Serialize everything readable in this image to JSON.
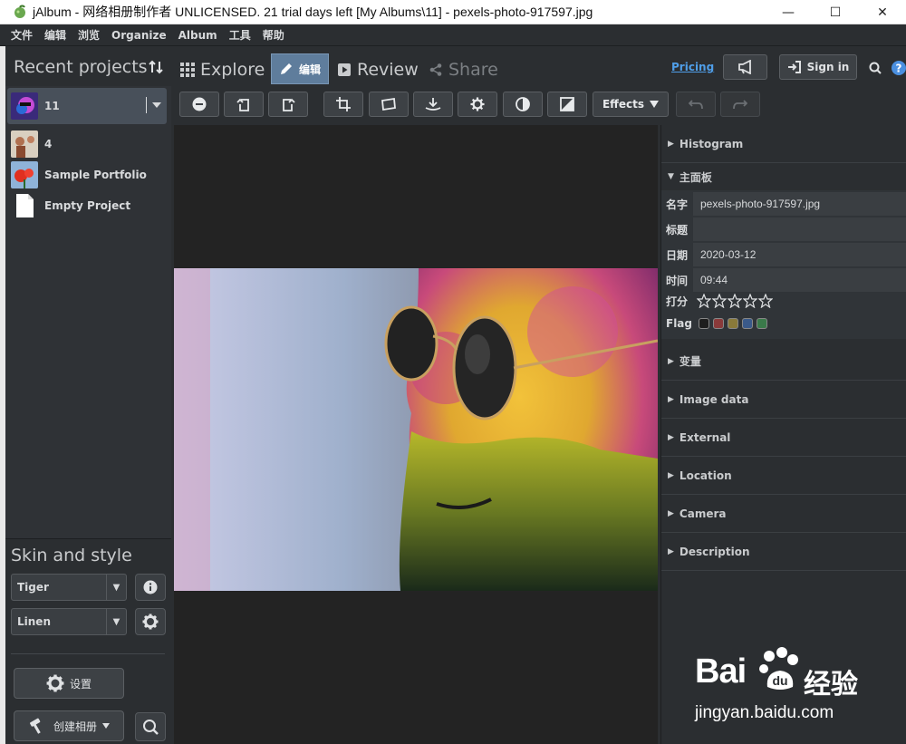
{
  "window": {
    "title": "jAlbum - 网络相册制作者 UNLICENSED. 21 trial days left [My Albums\\11] - pexels-photo-917597.jpg",
    "controls": {
      "minimize": "—",
      "maximize": "☐",
      "close": "✕"
    }
  },
  "menu": [
    "文件",
    "编辑",
    "浏览",
    "Organize",
    "Album",
    "工具",
    "帮助"
  ],
  "left": {
    "recent_header": "Recent projects",
    "projects": [
      {
        "name": "11",
        "selected": true
      },
      {
        "name": "4",
        "selected": false
      },
      {
        "name": "Sample Portfolio",
        "selected": false
      },
      {
        "name": "Empty Project",
        "selected": false
      }
    ],
    "skin_header": "Skin and style",
    "skin_value": "Tiger",
    "style_value": "Linen",
    "settings_label": "设置",
    "make_album_label": "创建相册"
  },
  "tabs": {
    "explore": "Explore",
    "edit": "编辑",
    "review": "Review",
    "share": "Share"
  },
  "topbar": {
    "pricing": "Pricing",
    "sign_in": "Sign in"
  },
  "edit_toolbar": {
    "effects": "Effects"
  },
  "right": {
    "sections_top": [
      "Histogram"
    ],
    "main_panel": "主面板",
    "fields": {
      "name_label": "名字",
      "name_value": "pexels-photo-917597.jpg",
      "title_label": "标题",
      "title_value": "",
      "date_label": "日期",
      "date_value": "2020-03-12",
      "time_label": "时间",
      "time_value": "09:44",
      "rating_label": "打分",
      "rating_value": 0,
      "flag_label": "Flag"
    },
    "flag_colors": [
      "#1e1e1e",
      "#8a3a3a",
      "#8a7a3a",
      "#3a5a8a",
      "#3a7a4a"
    ],
    "sections_bottom": [
      "变量",
      "Image data",
      "External",
      "Location",
      "Camera",
      "Description"
    ]
  },
  "watermark": {
    "logo": "Bai",
    "logo_cn": "经验",
    "url": "jingyan.baidu.com"
  }
}
